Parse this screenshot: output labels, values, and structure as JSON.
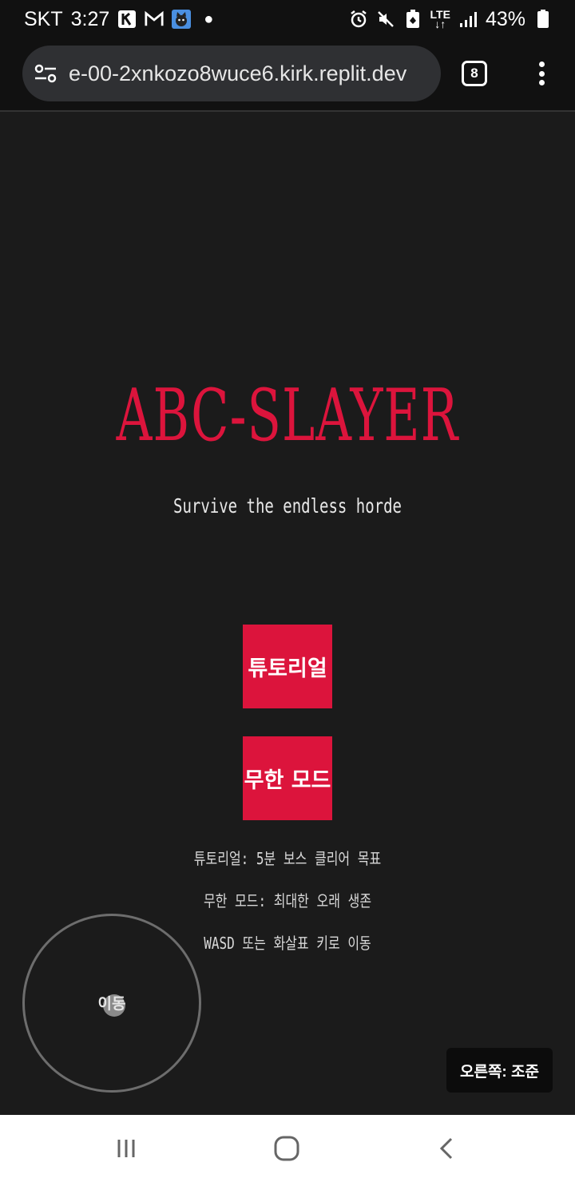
{
  "status_bar": {
    "carrier": "SKT",
    "time": "3:27",
    "network": "LTE",
    "battery": "43%"
  },
  "browser": {
    "url": "e-00-2xnkozo8wuce6.kirk.replit.dev",
    "tab_count": "8"
  },
  "game": {
    "title": "ABC-SLAYER",
    "subtitle": "Survive the endless horde",
    "buttons": {
      "tutorial": "튜토리얼",
      "endless": "무한 모드"
    },
    "info": [
      "튜토리얼: 5분 보스 클리어 목표",
      "무한 모드: 최대한 오래 생존",
      "WASD 또는 화살표 키로 이동"
    ],
    "joystick_label": "이동",
    "aim_hint": "오른쪽: 조준"
  },
  "colors": {
    "accent": "#dc143c",
    "background": "#1b1b1b",
    "bar_background": "#111111"
  }
}
